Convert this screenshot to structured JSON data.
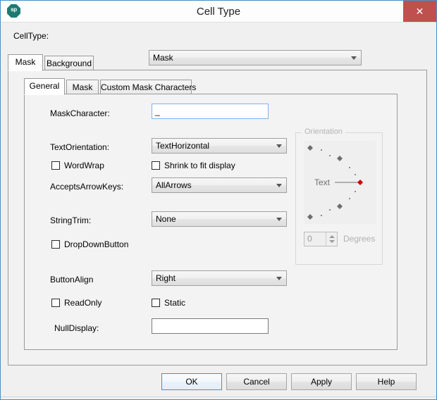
{
  "window": {
    "title": "Cell Type",
    "app_icon": "spread-icon",
    "app_icon_text": "sp",
    "close_label": "✕",
    "accent": "#4a90c4",
    "close_bg": "#c0504d"
  },
  "celltype": {
    "label": "CellType:",
    "value": "Mask"
  },
  "outer_tabs": [
    {
      "label": "Mask",
      "active": true
    },
    {
      "label": "Background",
      "active": false
    }
  ],
  "inner_tabs": [
    {
      "label": "General",
      "active": true
    },
    {
      "label": "Mask",
      "active": false
    },
    {
      "label": "Custom Mask Characters",
      "active": false
    }
  ],
  "general": {
    "mask_character": {
      "label": "MaskCharacter:",
      "value": "_"
    },
    "text_orientation": {
      "label": "TextOrientation:",
      "value": "TextHorizontal"
    },
    "word_wrap": {
      "label": "WordWrap",
      "checked": false
    },
    "shrink_to_fit": {
      "label": "Shrink to fit display",
      "checked": false
    },
    "accepts_arrow_keys": {
      "label": "AcceptsArrowKeys:",
      "value": "AllArrows"
    },
    "string_trim": {
      "label": "StringTrim:",
      "value": "None"
    },
    "drop_down_button": {
      "label": "DropDownButton",
      "checked": false
    },
    "button_align": {
      "label": "ButtonAlign",
      "value": "Right"
    },
    "read_only": {
      "label": "ReadOnly",
      "checked": false
    },
    "static": {
      "label": "Static",
      "checked": false
    },
    "null_display": {
      "label": "NullDisplay:",
      "value": ""
    }
  },
  "orientation": {
    "legend": "Orientation",
    "preview_text": "Text",
    "degrees_value": "0",
    "degrees_label": "Degrees",
    "disabled": true,
    "handle_color": "#7a7a7a",
    "selected_color": "#cc0000"
  },
  "buttons": {
    "ok": "OK",
    "cancel": "Cancel",
    "apply": "Apply",
    "help": "Help"
  }
}
